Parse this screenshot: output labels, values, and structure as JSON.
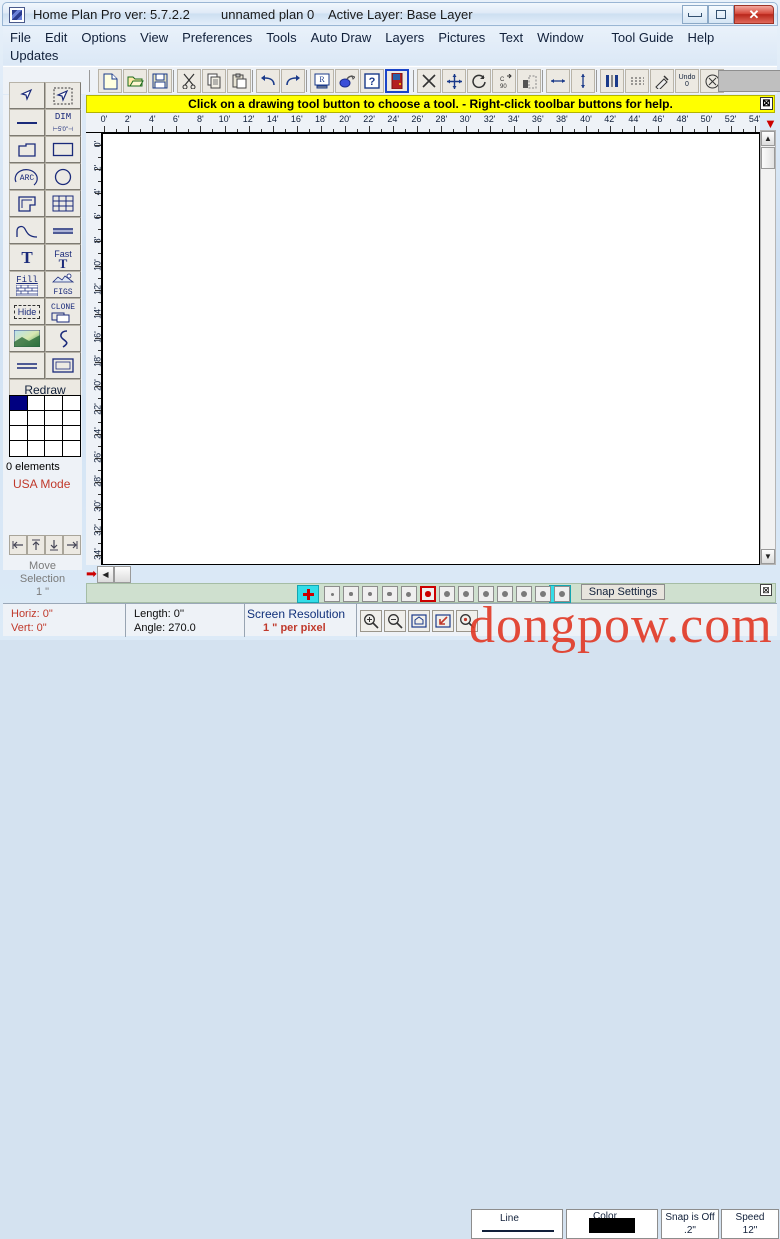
{
  "window": {
    "title": "Home Plan Pro ver: 5.7.2.2",
    "plan_name": "unnamed plan 0",
    "active_layer": "Active Layer: Base Layer",
    "minimize_label": "",
    "maximize_label": "",
    "close_label": "✕"
  },
  "menu": {
    "row1": [
      "File",
      "Edit",
      "Options",
      "View",
      "Preferences",
      "Tools",
      "Auto Draw",
      "Layers",
      "Pictures",
      "Text",
      "Window",
      "Tool Guide",
      "Help"
    ],
    "row2": [
      "Updates"
    ]
  },
  "toolbar": {
    "buttons": [
      "new-document",
      "open-folder",
      "save-disk",
      "cut-scissors",
      "copy-pages",
      "paste-clipboard",
      "undo-arrow",
      "redo-arrow",
      "print-preview",
      "paint-can",
      "help-question",
      "door-red"
    ],
    "buttons2": [
      "delete-x",
      "move-cross",
      "rotate-circle",
      "rotate-90",
      "align-dots",
      "horizontal-arrow",
      "vertical-arrow",
      "columns-bars",
      "dashed-lines",
      "eyedropper-pen"
    ],
    "undo_label": "Undo",
    "undo_count": "0",
    "cancel_icon": "cancel-circle"
  },
  "hint": {
    "text": "Click on a drawing tool button to choose a tool.  -  Right-click toolbar buttons for help.",
    "close": "⊠"
  },
  "left_tools": {
    "rows": [
      [
        "select-arrow",
        "select-box-arrow"
      ],
      [
        "line-tool",
        "dimension-tool"
      ],
      [
        "polygon-tool",
        "rectangle-tool"
      ],
      [
        "arc-tool",
        "circle-tool"
      ],
      [
        "room-tool",
        "window-grid-tool"
      ],
      [
        "curve-tool",
        "double-line-tool"
      ],
      [
        "text-tool",
        "fast-text-tool"
      ],
      [
        "fill-brick-tool",
        "figures-tool"
      ],
      [
        "hide-tool",
        "clone-tool"
      ],
      [
        "gradient-tool",
        "freehand-tool"
      ],
      [
        "parallel-lines-tool",
        "box-tool"
      ]
    ],
    "labels": {
      "dim": "DIM",
      "dim_sub": "5'0\"",
      "arc": "ARC",
      "fast": "Fast",
      "fill": "Fill",
      "figs": "FIGS",
      "hide": "Hide",
      "clone": "CLONE"
    },
    "redraw": "Redraw",
    "elements": "0 elements",
    "mode": "USA Mode",
    "move_selection": "Move",
    "move_selection2": "Selection",
    "move_amount": "1 \"",
    "nav": [
      "nudge-left",
      "nudge-up",
      "nudge-down",
      "nudge-right"
    ]
  },
  "rulers": {
    "h_unit": "'",
    "h_ticks": [
      "0'",
      "2'",
      "4'",
      "6'",
      "8'",
      "10'",
      "12'",
      "14'",
      "16'",
      "18'",
      "20'",
      "22'",
      "24'",
      "26'",
      "28'",
      "30'",
      "32'",
      "34'",
      "36'",
      "38'",
      "40'",
      "42'",
      "44'",
      "46'",
      "48'",
      "50'",
      "52'",
      "54'"
    ],
    "v_ticks": [
      "0'",
      "2'",
      "4'",
      "6'",
      "8'",
      "10'",
      "12'",
      "14'",
      "16'",
      "18'",
      "20'",
      "22'",
      "24'",
      "26'",
      "28'",
      "30'",
      "32'",
      "34'"
    ]
  },
  "snapbar": {
    "plus": "+",
    "minus": "−",
    "dot_count": 13,
    "selected_dot_index": 5,
    "snap_settings": "Snap Settings",
    "close": "⊠"
  },
  "status": {
    "horiz": "Horiz: 0\"",
    "vert": "Vert: 0\"",
    "length": "Length:  0''",
    "angle": "Angle:  270.0",
    "resolution_label": "Screen Resolution",
    "resolution_value": "1 \" per pixel",
    "zoom_buttons": [
      "zoom-in",
      "zoom-out",
      "zoom-fit",
      "zoom-selection",
      "zoom-find",
      "zoom-custom"
    ],
    "line_label": "Line",
    "color_label": "Color",
    "snap_label": "Snap is Off",
    "snap_value": ".2\"",
    "speed_label": "Speed",
    "speed_value": "12\""
  },
  "watermark": {
    "text": "dongpow.com",
    "color": "#e23b28"
  },
  "colors": {
    "titlebar_accent": "#cddff1",
    "hint_bg": "#ffff00",
    "close_button": "#b8271b",
    "usa_mode": "#c0392b",
    "snap_strip": "#cfe0cf",
    "cyan_button": "#33dde8"
  }
}
